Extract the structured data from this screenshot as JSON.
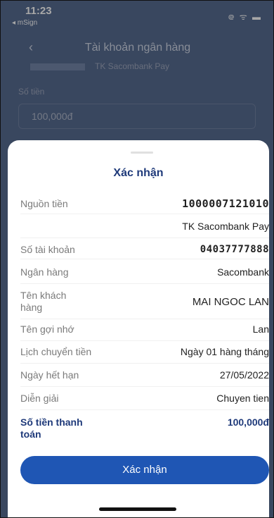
{
  "status_bar": {
    "time": "11:23",
    "back_app": "◂ mSign",
    "indicators": "᪤ ᯤ ▬"
  },
  "background": {
    "nav_title": "Tài khoản ngân hàng",
    "account_hint": "TK Sacombank Pay",
    "amount_label": "Số tiền",
    "amount_value": "100,000đ"
  },
  "sheet": {
    "title": "Xác nhận",
    "rows": [
      {
        "label": "Nguồn tiền",
        "value": "1000007121010"
      },
      {
        "label": "",
        "value": "TK Sacombank Pay"
      },
      {
        "label": "Số tài khoản",
        "value": "04037777888"
      },
      {
        "label": "Ngân hàng",
        "value": "Sacombank"
      },
      {
        "label": "Tên khách hàng",
        "value": "MAI NGOC LAN"
      },
      {
        "label": "Tên gợi nhớ",
        "value": "Lan"
      },
      {
        "label": "Lịch chuyển tiền",
        "value": "Ngày 01 hàng tháng"
      },
      {
        "label": "Ngày hết hạn",
        "value": "27/05/2022"
      },
      {
        "label": "Diễn giải",
        "value": "Chuyen tien"
      },
      {
        "label": "Số tiền thanh toán",
        "value": "100,000đ"
      }
    ],
    "confirm_label": "Xác nhận"
  }
}
